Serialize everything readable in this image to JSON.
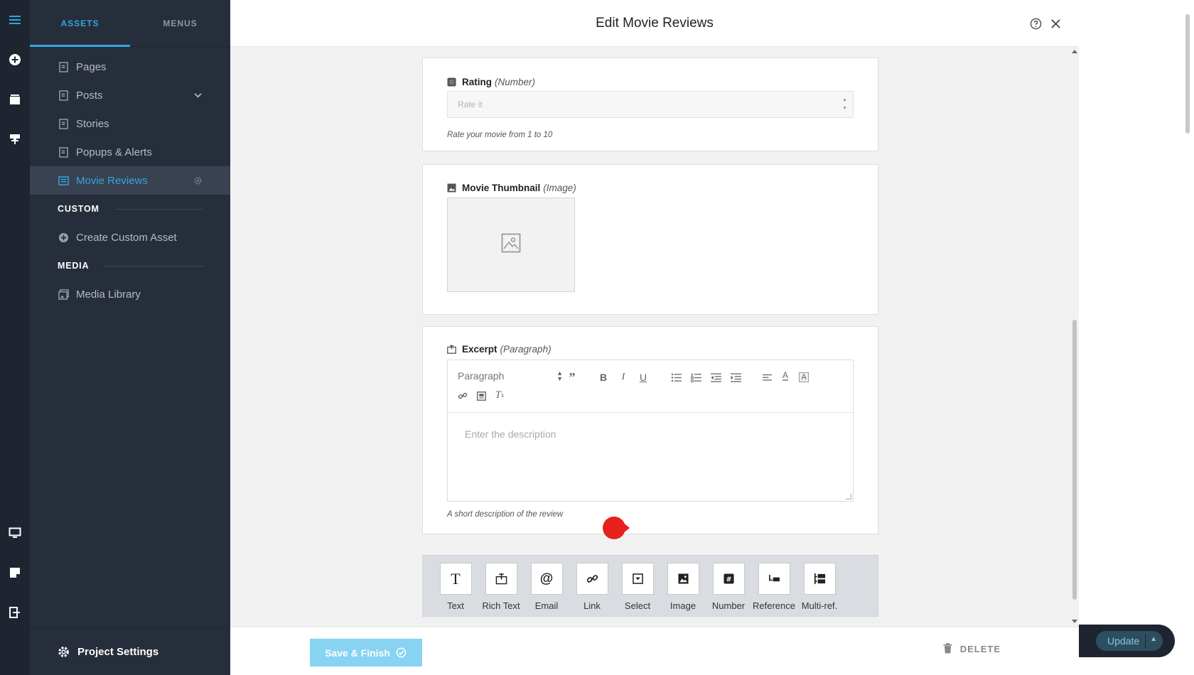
{
  "sidebar": {
    "tabs": [
      {
        "label": "ASSETS"
      },
      {
        "label": "MENUS"
      }
    ],
    "items": [
      {
        "label": "Pages"
      },
      {
        "label": "Posts"
      },
      {
        "label": "Stories"
      },
      {
        "label": "Popups & Alerts"
      },
      {
        "label": "Movie Reviews"
      }
    ],
    "custom_section": "CUSTOM",
    "create_custom": "Create Custom Asset",
    "media_section": "MEDIA",
    "media_library": "Media Library",
    "project_settings": "Project Settings"
  },
  "modal": {
    "title": "Edit Movie Reviews",
    "rating": {
      "label": "Rating",
      "type": "(Number)",
      "placeholder": "Rate it",
      "hint": "Rate your movie from 1 to 10"
    },
    "thumbnail": {
      "label": "Movie Thumbnail",
      "type": "(Image)"
    },
    "excerpt": {
      "label": "Excerpt",
      "type": "(Paragraph)",
      "format": "Paragraph",
      "placeholder": "Enter the description",
      "hint": "A short description of the review"
    },
    "field_types": [
      {
        "label": "Text"
      },
      {
        "label": "Rich Text"
      },
      {
        "label": "Email"
      },
      {
        "label": "Link"
      },
      {
        "label": "Select"
      },
      {
        "label": "Image"
      },
      {
        "label": "Number"
      },
      {
        "label": "Reference"
      },
      {
        "label": "Multi-ref."
      }
    ],
    "save_label": "Save & Finish",
    "delete_label": "DELETE"
  },
  "update_label": "Update",
  "colors": {
    "accent": "#2ea7e0",
    "sidebar_bg": "#272e3b",
    "rail_bg": "#1e2430",
    "save_bg": "#87d3f1",
    "pin": "#e8201c"
  }
}
